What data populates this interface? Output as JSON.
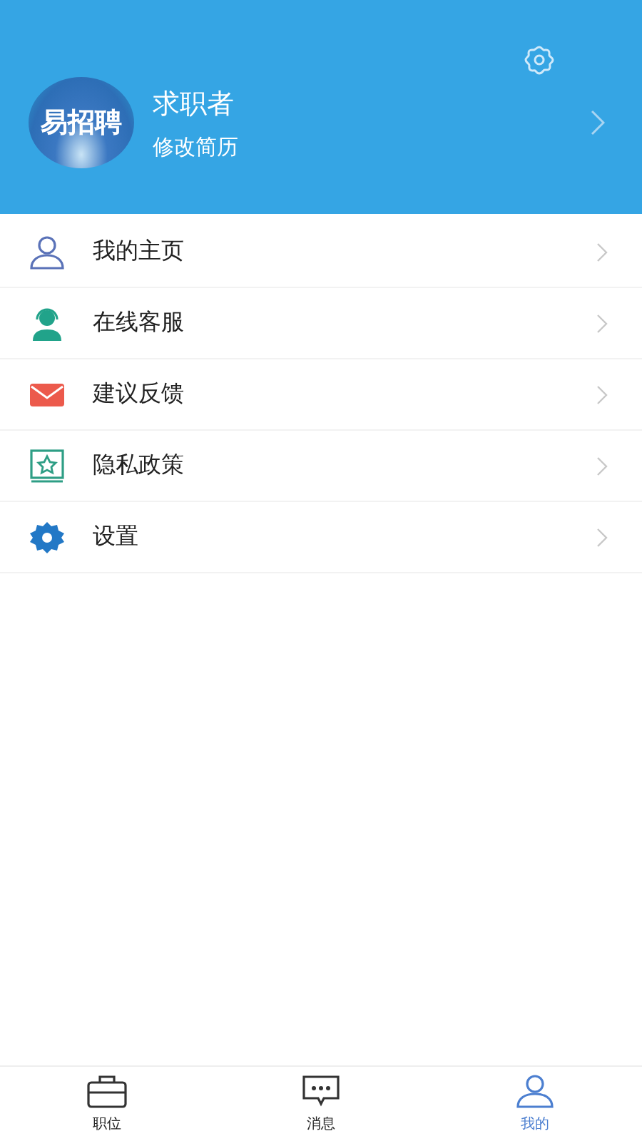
{
  "profile": {
    "logo_text": "易招聘",
    "name": "求职者",
    "subtitle": "修改简历"
  },
  "menu": [
    {
      "kind": "person",
      "label": "我的主页"
    },
    {
      "kind": "support",
      "label": "在线客服"
    },
    {
      "kind": "mail",
      "label": "建议反馈"
    },
    {
      "kind": "policy",
      "label": "隐私政策"
    },
    {
      "kind": "gear",
      "label": "设置"
    }
  ],
  "tabs": [
    {
      "kind": "briefcase",
      "label": "职位",
      "selected": false
    },
    {
      "kind": "chat",
      "label": "消息",
      "selected": false
    },
    {
      "kind": "person",
      "label": "我的",
      "selected": true
    }
  ]
}
